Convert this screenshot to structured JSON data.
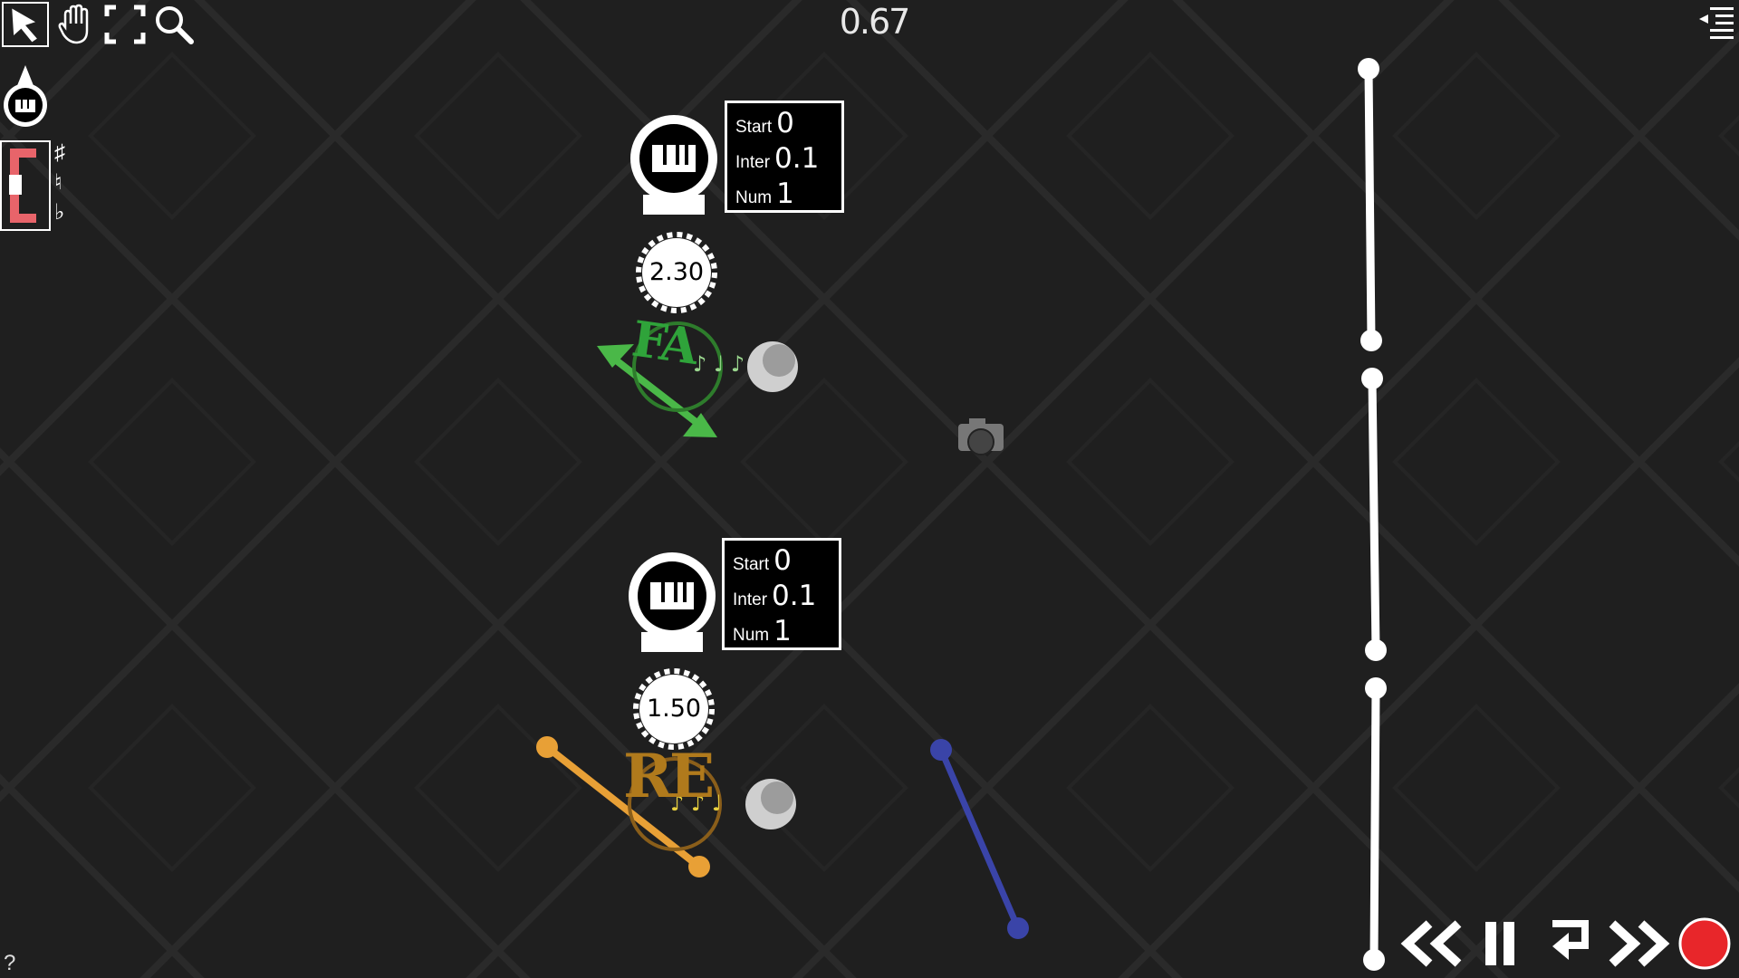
{
  "toolbar": {
    "tools": [
      {
        "name": "select",
        "icon": "pointer-arrow-icon"
      },
      {
        "name": "hand",
        "icon": "hand-icon"
      },
      {
        "name": "fullscreen",
        "icon": "fullscreen-icon"
      },
      {
        "name": "zoom",
        "icon": "magnifier-icon"
      }
    ],
    "piano_tool_icon": "piano-drop-icon",
    "key_selector": {
      "key": "C",
      "accidentals": [
        "♯",
        "♮",
        "♭"
      ]
    }
  },
  "timer": "0.67",
  "menu_icon": "indented-list-icon",
  "spawners": [
    {
      "start_label": "Start",
      "start_value": "0",
      "inter_label": "Inter",
      "inter_value": "0.1",
      "num_label": "Num",
      "num_value": "1",
      "gear_value": "2.30",
      "note": "FA",
      "note_color": "#2fa33a"
    },
    {
      "start_label": "Start",
      "start_value": "0",
      "inter_label": "Inter",
      "inter_value": "0.1",
      "num_label": "Num",
      "num_value": "1",
      "gear_value": "1.50",
      "note": "RE",
      "note_color": "#c88a1e"
    }
  ],
  "camera_icon": "camera-icon",
  "line_colors": {
    "green": "#4ab848",
    "orange": "#e8a036",
    "blue": "#3a44a8",
    "record": "#e8262a"
  },
  "playback": {
    "icons": [
      "rewind-icon",
      "pause-icon",
      "loop-icon",
      "fast-forward-icon",
      "record-icon"
    ]
  },
  "help": "?"
}
